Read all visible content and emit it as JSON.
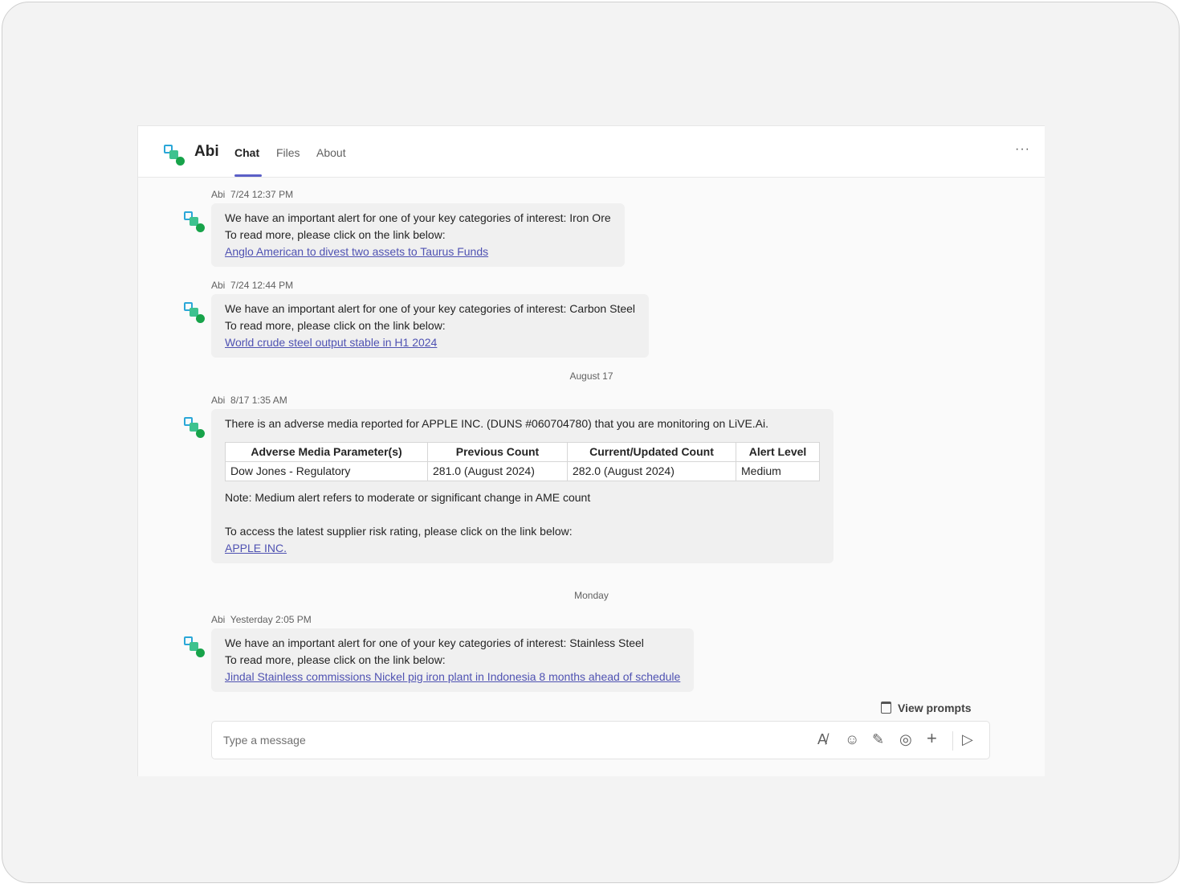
{
  "header": {
    "title": "Abi",
    "tabs": [
      {
        "label": "Chat",
        "active": true
      },
      {
        "label": "Files"
      },
      {
        "label": "About"
      }
    ],
    "more": "···"
  },
  "messages": [
    {
      "sender": "Abi",
      "time": "7/24 12:37 PM",
      "lines": [
        "We have an important alert for one of your key categories of interest: Iron Ore",
        "To read more, please click on the link below:"
      ],
      "link": "Anglo American to divest two assets to Taurus Funds"
    },
    {
      "sender": "Abi",
      "time": "7/24 12:44 PM",
      "lines": [
        "We have an important alert for one of your key categories of interest: Carbon Steel",
        "To read more, please click on the link below:"
      ],
      "link": "World crude steel output stable in H1 2024"
    },
    {
      "sender": "Abi",
      "time": "8/17 1:35 AM",
      "intro": "There is an adverse media reported for APPLE INC. (DUNS #060704780) that you are monitoring on LiVE.Ai.",
      "table": {
        "headers": [
          "Adverse Media Parameter(s)",
          "Previous Count",
          "Current/Updated Count",
          "Alert Level"
        ],
        "rows": [
          [
            "Dow Jones - Regulatory",
            "281.0 (August 2024)",
            "282.0 (August 2024)",
            "Medium"
          ]
        ]
      },
      "note": "Note: Medium alert refers to moderate or significant change in AME count",
      "access": "To access the latest supplier risk rating, please click on the link below:",
      "link": "APPLE INC."
    },
    {
      "sender": "Abi",
      "time": "Yesterday 2:05 PM",
      "lines": [
        "We have an important alert for one of your key categories of interest: Stainless Steel",
        "To read more, please click on the link below:"
      ],
      "link": "Jindal Stainless commissions Nickel pig iron plant in Indonesia 8 months ahead of schedule"
    }
  ],
  "dividers": [
    "August 17",
    "Monday"
  ],
  "compose": {
    "placeholder": "Type a message",
    "view_prompts": "View prompts"
  },
  "colors": {
    "accent": "#5b5fc7",
    "link": "#4f52b2"
  }
}
